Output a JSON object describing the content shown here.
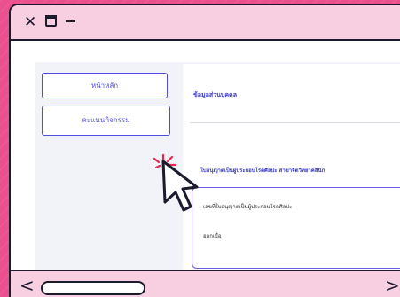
{
  "titlebar": {
    "close_icon": "close-icon",
    "restore_icon": "restore-icon",
    "minimize_icon": "minimize-icon",
    "close_glyph": "✕"
  },
  "nav": {
    "home_label": "หน้าหลัก",
    "scores_label": "คะแนนกิจกรรม"
  },
  "main": {
    "info_title": "ข้อมูลส่วนบุคคล",
    "license_heading": "ใบอนุญาตเป็นผู้ประกอบโรคศิลปะ สาขาจิตวิทยาคลินิก",
    "license_label": "เลขที่ใบอนุญาตเป็นผู้ประกอบโรคศิลปะ",
    "license_value": "ออกเมื่อ"
  },
  "scrollbar": {
    "left_glyph": "<",
    "right_glyph": ">"
  },
  "colors": {
    "background": "#ea4f8e",
    "chrome": "#f8cfe1",
    "accent": "#4f4ee0",
    "outline": "#1b1b2e"
  }
}
